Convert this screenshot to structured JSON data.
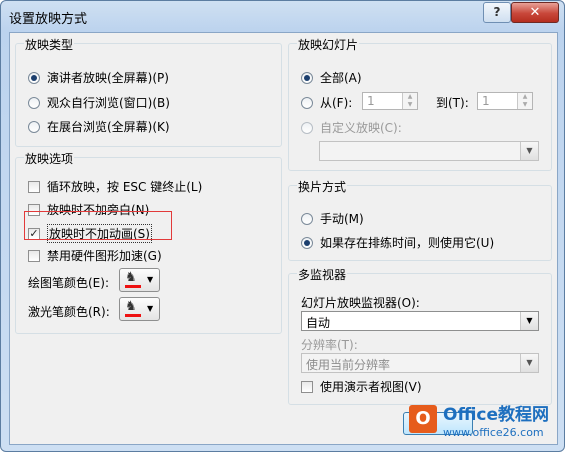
{
  "window": {
    "title": "设置放映方式",
    "help_label": "?",
    "close_label": "✕"
  },
  "show_type": {
    "title": "放映类型",
    "options": [
      {
        "label": "演讲者放映(全屏幕)(P)",
        "selected": true
      },
      {
        "label": "观众自行浏览(窗口)(B)",
        "selected": false
      },
      {
        "label": "在展台浏览(全屏幕)(K)",
        "selected": false
      }
    ]
  },
  "show_options": {
    "title": "放映选项",
    "loop_label": "循环放映，按 ESC 键终止(L)",
    "no_narration_label": "放映时不加旁白(N)",
    "no_animation_label": "放映时不加动画(S)",
    "no_animation_checked": true,
    "hw_accel_label": "禁用硬件图形加速(G)",
    "pen_color_label": "绘图笔颜色(E):",
    "laser_color_label": "激光笔颜色(R):",
    "pen_color": "#e01010",
    "laser_color": "#e01010"
  },
  "show_slides": {
    "title": "放映幻灯片",
    "all_label": "全部(A)",
    "from_label": "从(F):",
    "from_value": "1",
    "to_label": "到(T):",
    "to_value": "1",
    "custom_label": "自定义放映(C):",
    "custom_value": ""
  },
  "advance": {
    "title": "换片方式",
    "manual_label": "手动(M)",
    "timings_label": "如果存在排练时间，则使用它(U)"
  },
  "monitors": {
    "title": "多监视器",
    "slide_monitor_label": "幻灯片放映监视器(O):",
    "slide_monitor_value": "自动",
    "resolution_label": "分辨率(T):",
    "resolution_value": "使用当前分辨率",
    "presenter_view_label": "使用演示者视图(V)"
  },
  "watermark": {
    "logo_glyph": "O",
    "title": "Office教程网",
    "url": "www.office26.com"
  }
}
